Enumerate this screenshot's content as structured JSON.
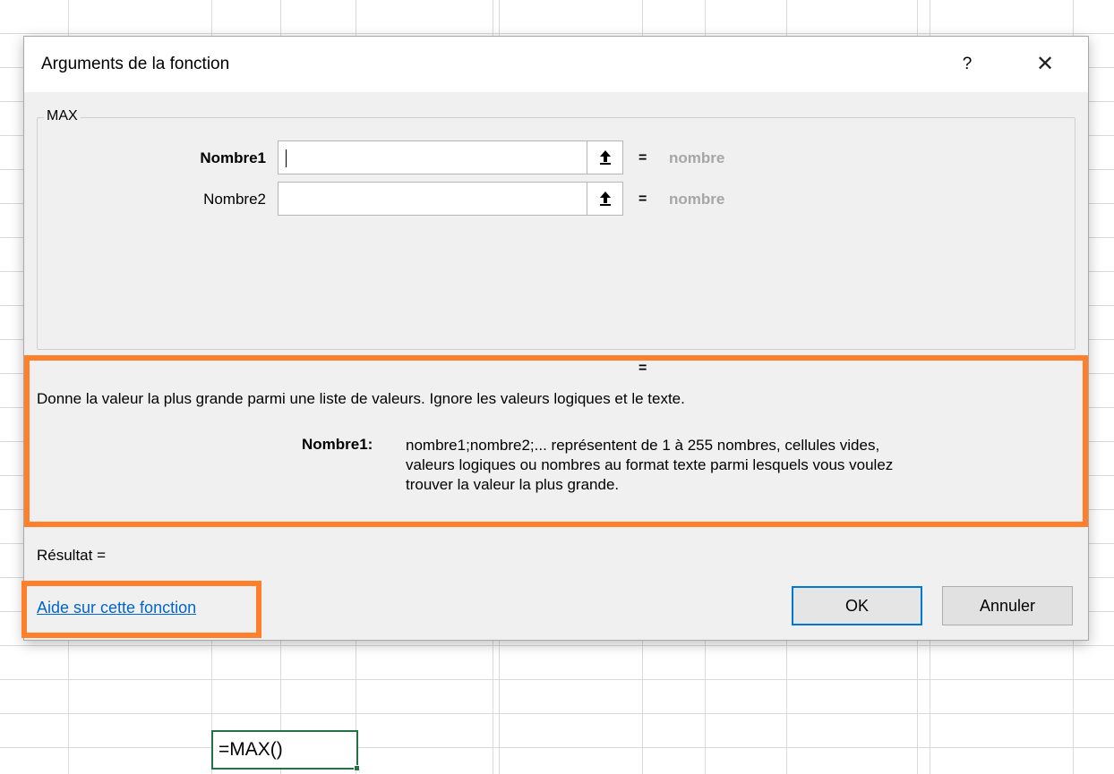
{
  "dialog": {
    "title": "Arguments de la fonction",
    "help_button": "?",
    "close_button": "✕",
    "function_name": "MAX",
    "arguments": [
      {
        "label": "Nombre1",
        "value": "",
        "result": "nombre",
        "equals": "="
      },
      {
        "label": "Nombre2",
        "value": "",
        "result": "nombre",
        "equals": "="
      }
    ],
    "description_equals": "=",
    "description": "Donne la valeur la plus grande parmi une liste de valeurs. Ignore les valeurs logiques et le texte.",
    "argument_help_label": "Nombre1:",
    "argument_help_lines": [
      "nombre1;nombre2;... représentent de 1 à 255 nombres, cellules vides,",
      "valeurs logiques ou nombres au format texte parmi lesquels vous voulez",
      "trouver la valeur la plus grande."
    ],
    "result_label": "Résultat =",
    "help_link": "Aide sur cette fonction",
    "ok_label": "OK",
    "cancel_label": "Annuler"
  },
  "sheet": {
    "active_cell_value": "=MAX()"
  },
  "colors": {
    "highlight": "#ff7f2a",
    "link": "#0066cc",
    "ok_border": "#0078d7",
    "cell_border": "#217346"
  }
}
